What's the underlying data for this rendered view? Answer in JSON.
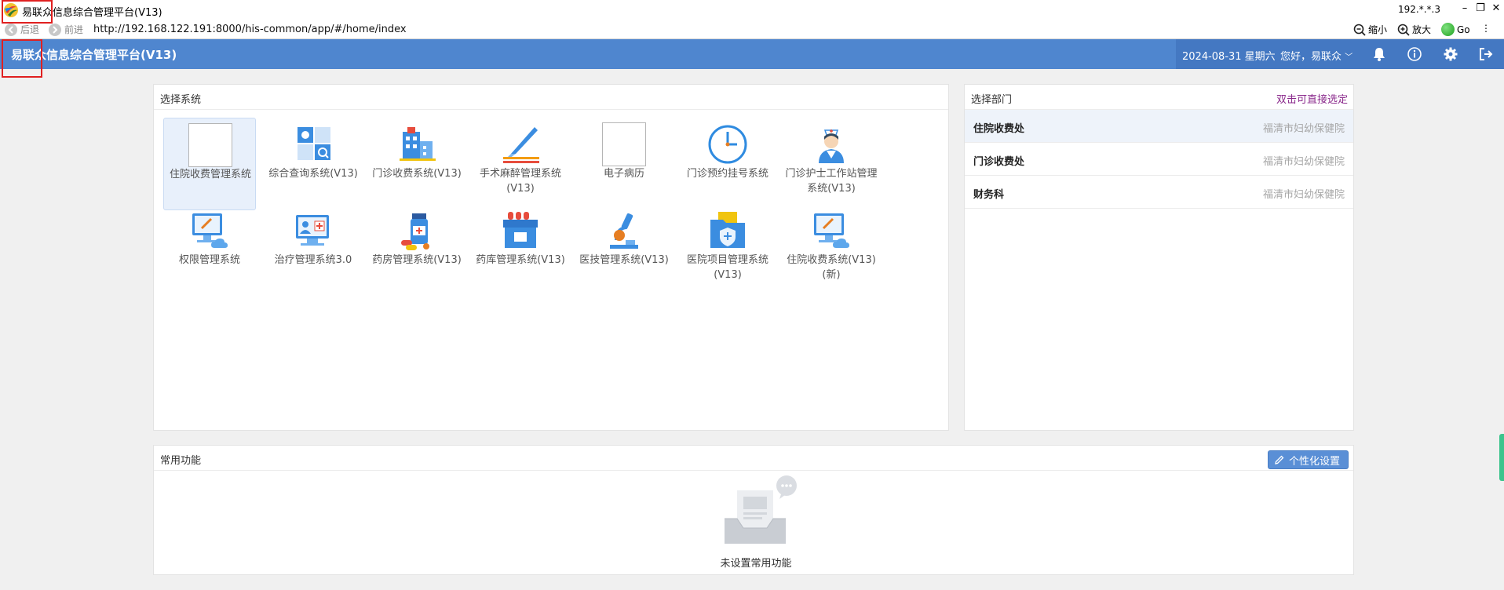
{
  "window": {
    "title": "易联众信息综合管理平台(V13)",
    "ip": "192.*.*.3",
    "minimize": "–",
    "restore": "❐",
    "close": "✕"
  },
  "browser": {
    "back_label": "后退",
    "forward_label": "前进",
    "url": "http://192.168.122.191:8000/his-common/app/#/home/index",
    "zoom_out_label": "缩小",
    "zoom_in_label": "放大",
    "go_label": "Go",
    "more": "⋮"
  },
  "header": {
    "title": "易联众信息综合管理平台(V13)",
    "date": "2024-08-31 星期六",
    "greeting": "您好，易联众",
    "greeting_arrow": "﹀"
  },
  "systems_panel": {
    "title": "选择系统",
    "items": [
      {
        "label": "住院收费管理系统",
        "icon": "broken-image-icon"
      },
      {
        "label": "综合查询系统(V13)",
        "icon": "search-panel-icon"
      },
      {
        "label": "门诊收费系统(V13)",
        "icon": "hospital-building-icon"
      },
      {
        "label": "手术麻醉管理系统(V13)",
        "icon": "scalpel-icon"
      },
      {
        "label": "电子病历",
        "icon": "broken-image-icon"
      },
      {
        "label": "门诊预约挂号系统",
        "icon": "clock-icon"
      },
      {
        "label": "门诊护士工作站管理系统(V13)",
        "icon": "nurse-icon"
      },
      {
        "label": "权限管理系统",
        "icon": "monitor-cloud-icon"
      },
      {
        "label": "治疗管理系统3.0",
        "icon": "medical-card-icon"
      },
      {
        "label": "药房管理系统(V13)",
        "icon": "pill-bottle-icon"
      },
      {
        "label": "药库管理系统(V13)",
        "icon": "medicine-box-icon"
      },
      {
        "label": "医技管理系统(V13)",
        "icon": "microscope-icon"
      },
      {
        "label": "医院项目管理系统(V13)",
        "icon": "folder-shield-icon"
      },
      {
        "label": "住院收费系统(V13)(新)",
        "icon": "monitor-cloud-icon"
      }
    ]
  },
  "dept_panel": {
    "title": "选择部门",
    "hint": "双击可直接选定",
    "items": [
      {
        "name": "住院收费处",
        "org": "福清市妇幼保健院"
      },
      {
        "name": "门诊收费处",
        "org": "福清市妇幼保健院"
      },
      {
        "name": "财务科",
        "org": "福清市妇幼保健院"
      }
    ]
  },
  "common_panel": {
    "title": "常用功能",
    "custom_button": "个性化设置",
    "empty_text": "未设置常用功能"
  },
  "colors": {
    "header_bg": "#4f86cf",
    "accent": "#5a8fd6",
    "hint": "#8b2a8c",
    "highlight_box": "#e02020"
  }
}
